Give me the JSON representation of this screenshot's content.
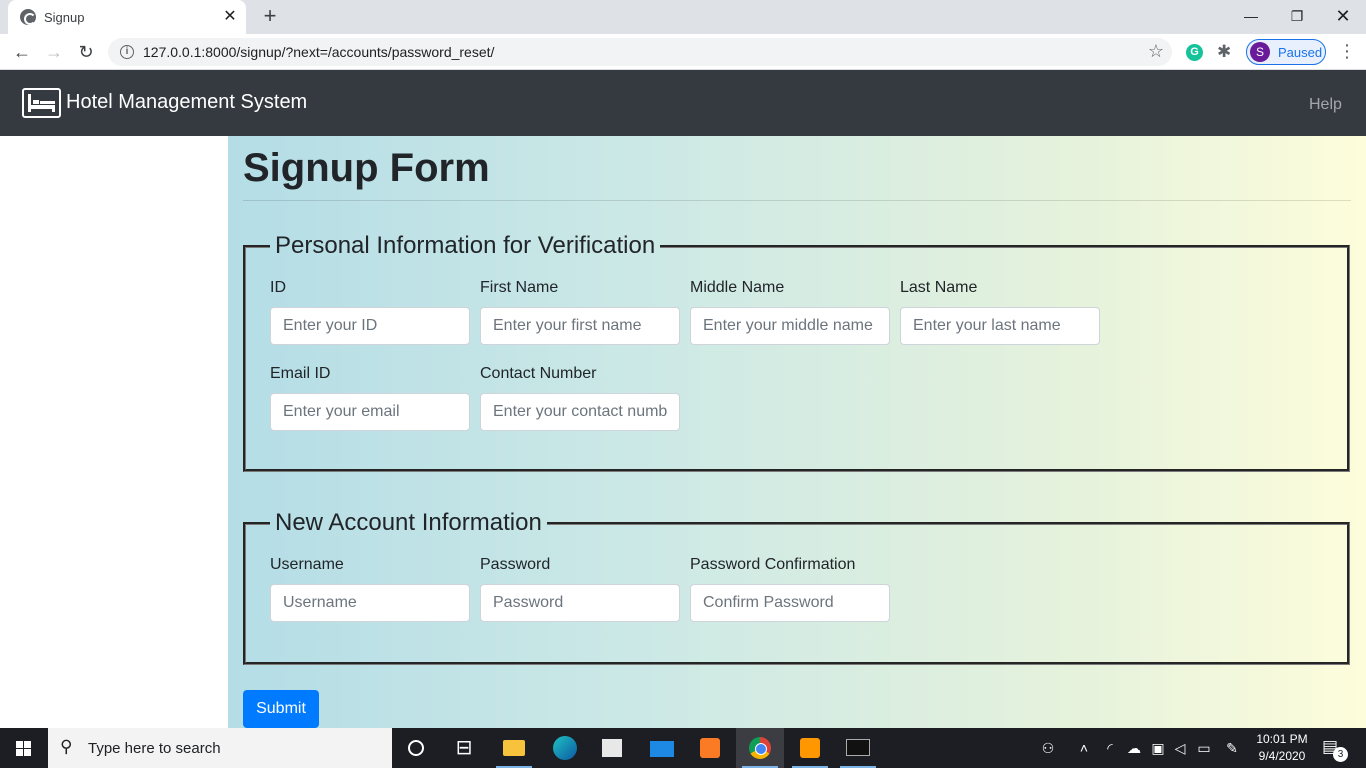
{
  "browser": {
    "tab_title": "Signup",
    "url": "127.0.0.1:8000/signup/?next=/accounts/password_reset/",
    "profile_initial": "S",
    "profile_status": "Paused",
    "grammarly_letter": "G"
  },
  "navbar": {
    "brand": "Hotel Management System",
    "help": "Help"
  },
  "page": {
    "title": "Signup Form"
  },
  "personal": {
    "legend": "Personal Information for Verification",
    "fields": [
      {
        "label": "ID",
        "placeholder": "Enter your ID"
      },
      {
        "label": "First Name",
        "placeholder": "Enter your first name"
      },
      {
        "label": "Middle Name",
        "placeholder": "Enter your middle name"
      },
      {
        "label": "Last Name",
        "placeholder": "Enter your last name"
      },
      {
        "label": "Email ID",
        "placeholder": "Enter your email"
      },
      {
        "label": "Contact Number",
        "placeholder": "Enter your contact numb"
      }
    ]
  },
  "account": {
    "legend": "New Account Information",
    "fields": [
      {
        "label": "Username",
        "placeholder": "Username"
      },
      {
        "label": "Password",
        "placeholder": "Password"
      },
      {
        "label": "Password Confirmation",
        "placeholder": "Confirm Password"
      }
    ]
  },
  "submit_label": "Submit",
  "taskbar": {
    "search_placeholder": "Type here to search",
    "time": "10:01 PM",
    "date": "9/4/2020",
    "notification_count": "3"
  },
  "colors": {
    "navbar_bg": "#343a40",
    "primary": "#007bff",
    "gradient_start": "#b4dde6",
    "gradient_end": "#fdfddb"
  }
}
